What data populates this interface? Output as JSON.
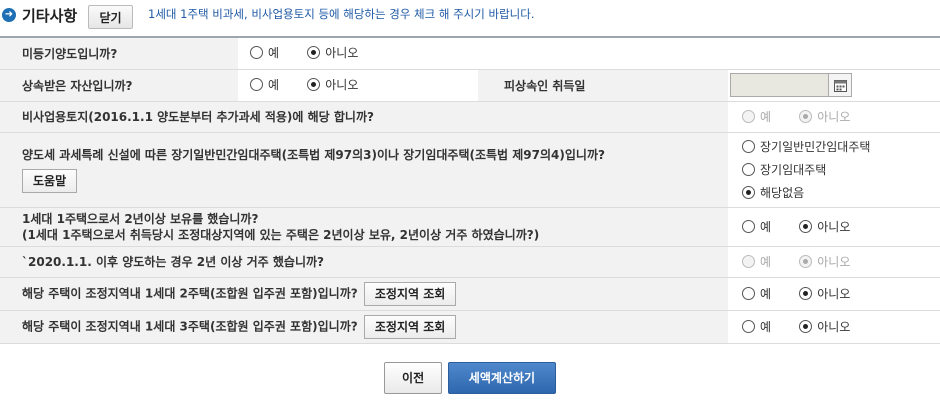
{
  "header": {
    "title": "기타사항",
    "close_label": "닫기",
    "description": "1세대 1주택 비과세, 비사업용토지 등에 해당하는 경우 체크 해 주시기 바랍니다."
  },
  "options": {
    "yes": "예",
    "no": "아니오"
  },
  "rows": {
    "unregistered": {
      "question": "미등기양도입니까?",
      "selected": "아니오"
    },
    "inherited": {
      "question": "상속받은 자산입니까?",
      "selected": "아니오",
      "sub_label": "피상속인 취득일",
      "date_value": ""
    },
    "nonbusiness_land": {
      "question": "비사업용토지(2016.1.1 양도분부터 추가과세 적용)에 해당 합니까?",
      "selected": "아니오",
      "disabled": true
    },
    "rental_housing": {
      "question": "양도세 과세특례 신설에 따른 장기일반민간임대주택(조특법 제97의3)이나 장기임대주택(조특법 제97의4)입니까?",
      "help_label": "도움말",
      "choices": [
        "장기일반민간임대주택",
        "장기임대주택",
        "해당없음"
      ],
      "selected": "해당없음"
    },
    "one_house": {
      "question_line1": "1세대 1주택으로서 2년이상 보유를 했습니까?",
      "question_line2": "(1세대 1주택으로서 취득당시 조정대상지역에 있는 주택은 2년이상 보유, 2년이상 거주 하였습니까?)",
      "selected": "아니오"
    },
    "residence_2020": {
      "question": "`2020.1.1. 이후 양도하는 경우 2년 이상 거주 했습니까?",
      "selected": "아니오",
      "disabled": true
    },
    "two_house": {
      "question": "해당 주택이 조정지역내 1세대 2주택(조합원 입주권 포함)입니까?",
      "lookup_label": "조정지역 조회",
      "selected": "아니오"
    },
    "three_house": {
      "question": "해당 주택이 조정지역내 1세대 3주택(조합원 입주권 포함)입니까?",
      "lookup_label": "조정지역 조회",
      "selected": "아니오"
    }
  },
  "footer": {
    "prev_label": "이전",
    "calc_label": "세액계산하기"
  },
  "colors": {
    "accent": "#1f5aa6",
    "primary_button": "#3a74bb",
    "header_band": "#f2f2f2"
  }
}
